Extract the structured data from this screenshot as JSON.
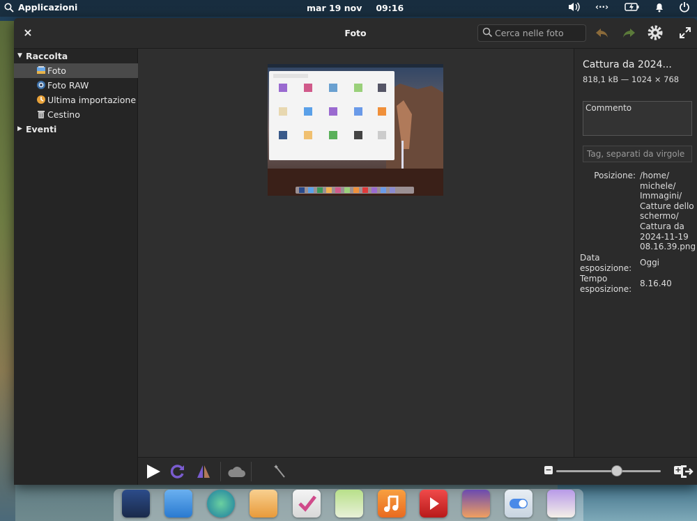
{
  "panel": {
    "apps_label": "Applicazioni",
    "date": "mar 19 nov",
    "time": "09:16",
    "tray_icons": [
      "volume-icon",
      "network-icon",
      "battery-icon",
      "notifications-icon",
      "power-icon"
    ]
  },
  "window": {
    "title": "Foto",
    "close_label": "×",
    "search_placeholder": "Cerca nelle foto"
  },
  "sidebar": {
    "groups": [
      {
        "label": "Raccolta",
        "expanded": true
      },
      {
        "label": "Eventi",
        "expanded": false
      }
    ],
    "items": [
      {
        "label": "Foto",
        "icon": "photos-library-icon",
        "selected": true
      },
      {
        "label": "Foto RAW",
        "icon": "camera-raw-icon",
        "selected": false
      },
      {
        "label": "Ultima importazione",
        "icon": "last-import-icon",
        "selected": false
      },
      {
        "label": "Cestino",
        "icon": "trash-icon",
        "selected": false
      }
    ]
  },
  "info": {
    "filename": "Cattura da 2024...",
    "meta": "818,1 kB — 1024 × 768",
    "comment_label": "Commento",
    "tags_placeholder": "Tag, separati da virgole",
    "position_label": "Posizione:",
    "position_value": "/home/ michele/ Immagini/ Catture dello schermo/ Cattura da 2024-11-19 08.16.39.png",
    "date_label": "Data esposizione:",
    "date_value": "Oggi",
    "time_label": "Tempo esposizione:",
    "time_value": "8.16.40"
  },
  "toolbar": {
    "zoom_level": 0.58
  },
  "dock": {
    "apps": [
      "multitasking-icon",
      "files-icon",
      "web-browser-icon",
      "mail-icon",
      "tasks-icon",
      "calendar-icon",
      "music-icon",
      "videos-icon",
      "photos-icon",
      "settings-icon",
      "appcenter-icon"
    ]
  },
  "colors": {
    "window_bg": "#2e2e2e",
    "sidebar_bg": "#252525",
    "selection": "#4a4a4a",
    "accent_purple": "#7a5ccf"
  }
}
